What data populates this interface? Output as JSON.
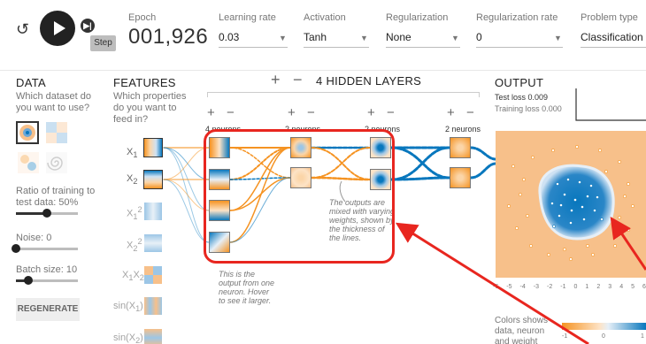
{
  "controls": {
    "step_tooltip": "Step"
  },
  "top": {
    "epoch_label": "Epoch",
    "epoch_value": "001,926",
    "lr_label": "Learning rate",
    "lr_value": "0.03",
    "act_label": "Activation",
    "act_value": "Tanh",
    "reg_label": "Regularization",
    "reg_value": "None",
    "regrate_label": "Regularization rate",
    "regrate_value": "0",
    "ptype_label": "Problem type",
    "ptype_value": "Classification"
  },
  "data": {
    "title": "DATA",
    "subtitle": "Which dataset do you want to use?",
    "ratio_label": "Ratio of training to test data:  50%",
    "ratio_value": 0.5,
    "noise_label": "Noise:  0",
    "noise_value": 0,
    "batch_label": "Batch size:  10",
    "batch_value": 0.2,
    "regenerate": "REGENERATE"
  },
  "features": {
    "title": "FEATURES",
    "subtitle": "Which properties do you want to feed in?",
    "items": [
      "X",
      "X",
      "X",
      "X",
      "X",
      "sin(X",
      "sin(X"
    ]
  },
  "network": {
    "title": "4  HIDDEN LAYERS",
    "layer_labels": [
      "4 neurons",
      "2 neurons",
      "2 neurons",
      "2 neurons"
    ],
    "tip1": "This is the output from one neuron. Hover to see it larger.",
    "tip2": "The outputs are mixed with varying weights, shown by the thickness of the lines."
  },
  "output": {
    "title": "OUTPUT",
    "test_loss": "Test loss 0.009",
    "train_loss": "Training loss 0.000",
    "axis_ticks": [
      "-6",
      "-5",
      "-4",
      "-3",
      "-2",
      "-1",
      "0",
      "1",
      "2",
      "3",
      "4",
      "5",
      "6"
    ],
    "legend_text": "Colors shows data, neuron and weight values.",
    "legend_ticks": [
      "-1",
      "0",
      "1"
    ]
  },
  "colors": {
    "orange": "#f59322",
    "blue": "#0877bd",
    "annotation": "#e8261f"
  }
}
